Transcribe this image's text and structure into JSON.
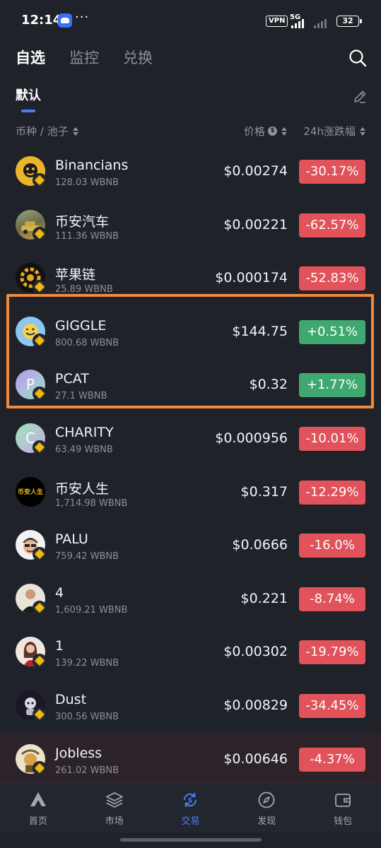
{
  "status_bar": {
    "time": "12:14",
    "dots": "···",
    "vpn": "VPN",
    "network": "5G",
    "battery": "32"
  },
  "top_tabs": [
    {
      "label": "自选",
      "active": true
    },
    {
      "label": "监控",
      "active": false
    },
    {
      "label": "兑换",
      "active": false
    }
  ],
  "sub_tab": {
    "label": "默认"
  },
  "columns": {
    "pair": "币种 / 池子",
    "price": "价格",
    "price_info": "$",
    "change": "24h涨跌幅"
  },
  "tokens": [
    {
      "name": "Binancians",
      "pool": "128.03 WBNB",
      "price": "$0.00274",
      "change": "-30.17%",
      "direction": "down"
    },
    {
      "name": "币安汽车",
      "pool": "111.36 WBNB",
      "price": "$0.00221",
      "change": "-62.57%",
      "direction": "down"
    },
    {
      "name": "苹果链",
      "pool": "25.89 WBNB",
      "price": "$0.000174",
      "change": "-52.83%",
      "direction": "down"
    },
    {
      "name": "GIGGLE",
      "pool": "800.68 WBNB",
      "price": "$144.75",
      "change": "+0.51%",
      "direction": "up"
    },
    {
      "name": "PCAT",
      "pool": "27.1 WBNB",
      "price": "$0.32",
      "change": "+1.77%",
      "direction": "up"
    },
    {
      "name": "CHARITY",
      "pool": "63.49 WBNB",
      "price": "$0.000956",
      "change": "-10.01%",
      "direction": "down"
    },
    {
      "name": "币安人生",
      "pool": "1,714.98 WBNB",
      "price": "$0.317",
      "change": "-12.29%",
      "direction": "down"
    },
    {
      "name": "PALU",
      "pool": "759.42 WBNB",
      "price": "$0.0666",
      "change": "-16.0%",
      "direction": "down"
    },
    {
      "name": "4",
      "pool": "1,609.21 WBNB",
      "price": "$0.221",
      "change": "-8.74%",
      "direction": "down"
    },
    {
      "name": "1",
      "pool": "139.22 WBNB",
      "price": "$0.00302",
      "change": "-19.79%",
      "direction": "down"
    },
    {
      "name": "Dust",
      "pool": "300.56 WBNB",
      "price": "$0.00829",
      "change": "-34.45%",
      "direction": "down"
    },
    {
      "name": "Jobless",
      "pool": "261.02 WBNB",
      "price": "$0.00646",
      "change": "-4.37%",
      "direction": "down"
    }
  ],
  "avatar_letters": {
    "pcat": "P",
    "charity": "C",
    "bian_rensheng": "币安人生"
  },
  "colors": {
    "background": "#1f2229",
    "accent": "#4a7cf6",
    "down": "#e1525a",
    "up": "#3fa870",
    "highlight": "#f08a3c"
  },
  "bottom_nav": [
    {
      "label": "首页",
      "icon": "home-logo-icon",
      "active": false
    },
    {
      "label": "市场",
      "icon": "layers-icon",
      "active": false
    },
    {
      "label": "交易",
      "icon": "swap-icon",
      "active": true
    },
    {
      "label": "发现",
      "icon": "compass-icon",
      "active": false
    },
    {
      "label": "钱包",
      "icon": "wallet-icon",
      "active": false
    }
  ]
}
